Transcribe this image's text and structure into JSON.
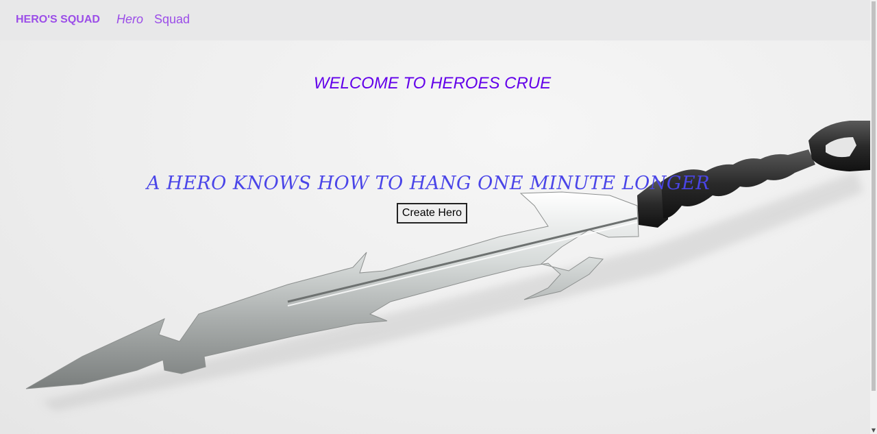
{
  "navbar": {
    "brand": "HERO'S SQUAD",
    "links": [
      {
        "label": "Hero"
      },
      {
        "label": "Squad"
      }
    ]
  },
  "main": {
    "welcome": "WELCOME TO HEROES CRUE",
    "tagline": "A HERO KNOWS HOW TO HANG ONE MINUTE LONGER",
    "create_button": "Create Hero"
  },
  "colors": {
    "brand": "#9b4de8",
    "heading": "#6200ea",
    "tagline": "#4a45e8",
    "navbar_bg": "#e8e8e9"
  },
  "icons": {
    "background": "sword-image",
    "scroll_down": "chevron-down-icon"
  }
}
